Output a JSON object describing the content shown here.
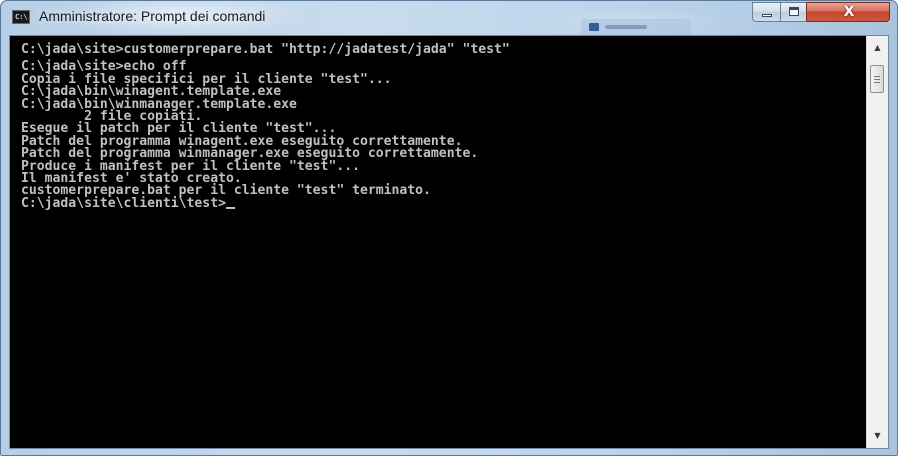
{
  "window": {
    "title": "Amministratore: Prompt dei comandi",
    "icon": "cmd-console-icon",
    "icon_text": "C:\\"
  },
  "caption_buttons": {
    "minimize_icon": "minimize-icon",
    "maximize_icon": "maximize-icon",
    "close_icon": "close-icon",
    "close_glyph": "X"
  },
  "console": {
    "colors": {
      "background": "#000000",
      "text": "#c0c0c0"
    },
    "lines": [
      "C:\\jada\\site>customerprepare.bat \"http://jadatest/jada\" \"test\"",
      "",
      "C:\\jada\\site>echo off",
      "Copia i file specifici per il cliente \"test\"...",
      "C:\\jada\\bin\\winagent.template.exe",
      "C:\\jada\\bin\\winmanager.template.exe",
      "        2 file copiati.",
      "Esegue il patch per il cliente \"test\"...",
      "Patch del programma winagent.exe eseguito correttamente.",
      "Patch del programma winmanager.exe eseguito correttamente.",
      "Produce i manifest per il cliente \"test\"...",
      "Il manifest e' stato creato.",
      "customerprepare.bat per il cliente \"test\" terminato.",
      "C:\\jada\\site\\clienti\\test>"
    ]
  },
  "scrollbar": {
    "up_arrow": "▲",
    "down_arrow": "▼",
    "position_fraction": 0.0
  }
}
